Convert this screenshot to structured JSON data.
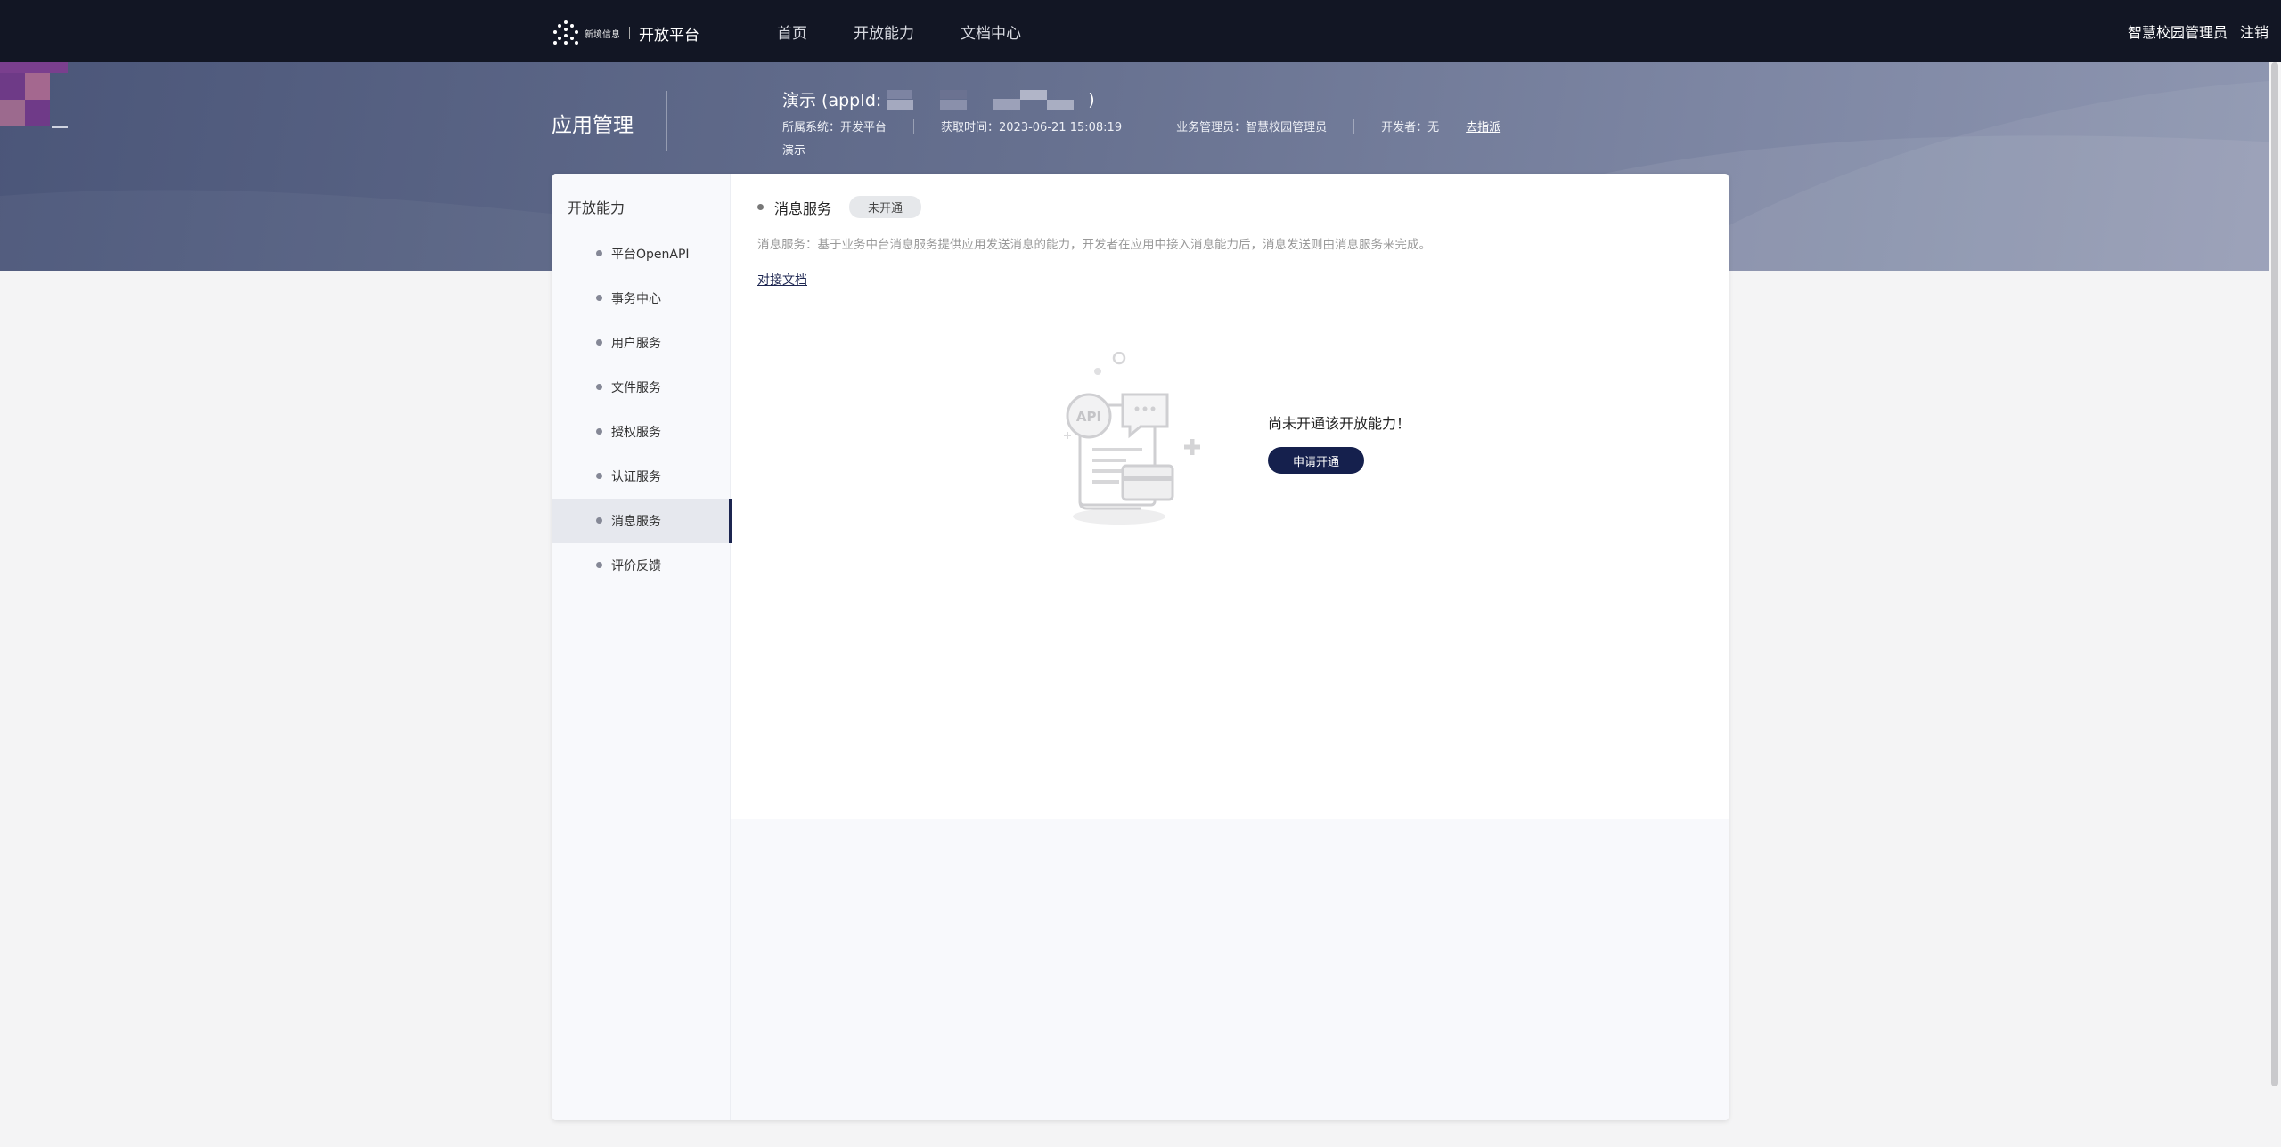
{
  "topnav": {
    "logo_small": "新境信息",
    "logo_title": "开放平台",
    "links": [
      "首页",
      "开放能力",
      "文档中心"
    ],
    "user": "智慧校园管理员",
    "logout": "注销"
  },
  "header": {
    "section_title": "应用管理",
    "app_name_prefix": "演示 (appId:",
    "app_name_suffix": ")",
    "system": "所属系统：开发平台",
    "time": "获取时间：2023-06-21 15:08:19",
    "manager": "业务管理员：智慧校园管理员",
    "developer": "开发者：无",
    "assign_link": "去指派",
    "app_sub": "演示"
  },
  "sidebar": {
    "title": "开放能力",
    "items": [
      {
        "label": "平台OpenAPI"
      },
      {
        "label": "事务中心"
      },
      {
        "label": "用户服务"
      },
      {
        "label": "文件服务"
      },
      {
        "label": "授权服务"
      },
      {
        "label": "认证服务"
      },
      {
        "label": "消息服务",
        "active": true
      },
      {
        "label": "评价反馈"
      }
    ]
  },
  "content": {
    "service_title": "消息服务",
    "status_badge": "未开通",
    "description": "消息服务：基于业务中台消息服务提供应用发送消息的能力，开发者在应用中接入消息能力后，消息发送则由消息服务来完成。",
    "doc_link": "对接文档",
    "empty_text": "尚未开通该开放能力！",
    "apply_button": "申请开通"
  },
  "colors": {
    "nav_bg": "#121624",
    "accent": "#15204d",
    "active_item_bg": "#e6e8ee"
  }
}
